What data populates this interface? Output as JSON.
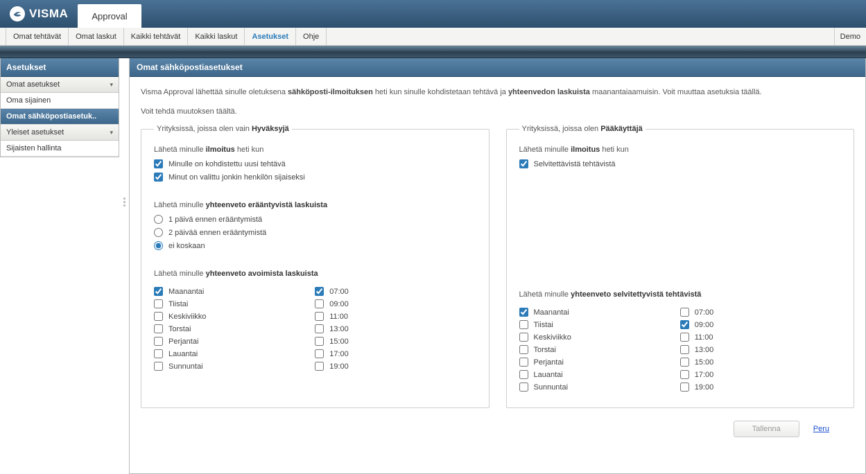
{
  "header": {
    "brand": "VISMA",
    "app_tab": "Approval"
  },
  "nav": {
    "items": [
      "Omat tehtävät",
      "Omat laskut",
      "Kaikki tehtävät",
      "Kaikki laskut",
      "Asetukset",
      "Ohje"
    ],
    "active_index": 4,
    "right_label": "Demo"
  },
  "sidebar": {
    "heading": "Asetukset",
    "group1": "Omat asetukset",
    "link_oma": "Oma sijainen",
    "link_email": "Omat sähköpostiasetuk..",
    "group2": "Yleiset asetukset",
    "link_sub": "Sijaisten hallinta"
  },
  "content": {
    "heading": "Omat sähköpostiasetukset",
    "intro_parts": {
      "p1a": "Visma Approval lähettää sinulle oletuksena ",
      "p1b": "sähköposti-ilmoituksen",
      "p1c": " heti kun sinulle kohdistetaan tehtävä ja ",
      "p1d": "yhteenvedon laskuista",
      "p1e": " maanantaiaamuisin. Voit muuttaa asetuksia täällä.",
      "p2": "Voit tehdä muutoksen täältä."
    },
    "panel_left": {
      "legend_prefix": "Yrityksissä, joissa olen vain ",
      "legend_bold": "Hyväksyjä",
      "s1_prefix": "Lähetä minulle ",
      "s1_bold": "ilmoitus",
      "s1_suffix": " heti kun",
      "cb_new_task": "Minulle on kohdistettu uusi tehtävä",
      "cb_substitute": "Minut on valittu jonkin henkilön sijaiseksi",
      "s2_prefix": "Lähetä minulle ",
      "s2_bold": "yhteenveto erääntyvistä laskuista",
      "r1": "1 päivä ennen erääntymistä",
      "r2": "2 päivää ennen erääntymistä",
      "r3": "ei koskaan",
      "s3_prefix": "Lähetä minulle ",
      "s3_bold": "yhteenveto avoimista laskuista",
      "days": [
        "Maanantai",
        "Tiistai",
        "Keskiviikko",
        "Torstai",
        "Perjantai",
        "Lauantai",
        "Sunnuntai"
      ],
      "times": [
        "07:00",
        "09:00",
        "11:00",
        "13:00",
        "15:00",
        "17:00",
        "19:00"
      ],
      "days_checked": [
        true,
        false,
        false,
        false,
        false,
        false,
        false
      ],
      "times_checked": [
        true,
        false,
        false,
        false,
        false,
        false,
        false
      ]
    },
    "panel_right": {
      "legend_prefix": "Yrityksissä, joissa olen ",
      "legend_bold": "Pääkäyttäjä",
      "s1_prefix": "Lähetä minulle ",
      "s1_bold": "ilmoitus",
      "s1_suffix": " heti kun",
      "cb_investigate": "Selvitettävistä tehtävistä",
      "s3_prefix": "Lähetä minulle ",
      "s3_bold": "yhteenveto selvitettyvistä tehtävistä",
      "days": [
        "Maanantai",
        "Tiistai",
        "Keskiviikko",
        "Torstai",
        "Perjantai",
        "Lauantai",
        "Sunnuntai"
      ],
      "times": [
        "07:00",
        "09:00",
        "11:00",
        "13:00",
        "15:00",
        "17:00",
        "19:00"
      ],
      "days_checked": [
        true,
        false,
        false,
        false,
        false,
        false,
        false
      ],
      "times_checked": [
        false,
        true,
        false,
        false,
        false,
        false,
        false
      ]
    },
    "footer": {
      "save": "Tallenna",
      "cancel": "Peru"
    }
  }
}
